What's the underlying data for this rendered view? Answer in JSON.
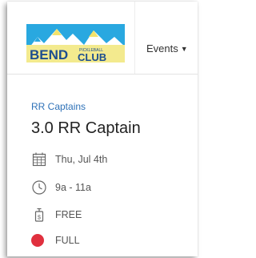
{
  "logo": {
    "brand_left": "BEND",
    "brand_small": "PICKLEBALL",
    "brand_right": "CLUB"
  },
  "nav": {
    "events_label": "Events"
  },
  "event": {
    "category": "RR Captains",
    "title": "3.0 RR Captain",
    "date": "Thu, Jul 4th",
    "time": "9a - 11a",
    "price": "FREE",
    "status": "FULL",
    "status_color": "#e0303e"
  },
  "icons": {
    "date": "calendar-icon",
    "time": "clock-icon",
    "price": "price-tag-icon",
    "status": "status-dot-icon"
  }
}
